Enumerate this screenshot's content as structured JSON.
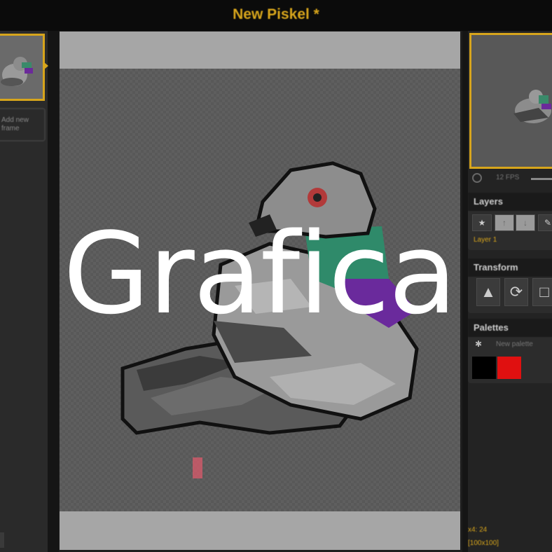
{
  "app": {
    "title": "New Piskel *"
  },
  "frames": {
    "add_label": "Add new frame"
  },
  "preview": {
    "fps_label": "12 FPS"
  },
  "layers": {
    "header": "Layers",
    "layer_name": "Layer 1",
    "tools": [
      "add-icon",
      "up-icon",
      "down-icon",
      "edit-icon"
    ]
  },
  "transform": {
    "header": "Transform",
    "tools": [
      "flip-icon",
      "rotate-icon",
      "clone-icon"
    ]
  },
  "palettes": {
    "header": "Palettes",
    "select_placeholder": "New palette",
    "colors": [
      "#000000",
      "#e01010"
    ]
  },
  "status": {
    "cursor": "x4: 24",
    "zoom": "[100x100]"
  },
  "overlay": {
    "text": "Grafica"
  },
  "colors": {
    "accent": "#d7a51c",
    "background": "#1e1e1e"
  }
}
